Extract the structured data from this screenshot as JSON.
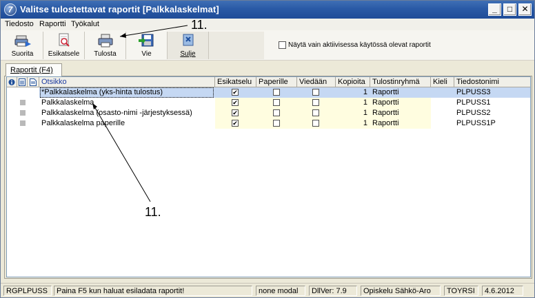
{
  "window": {
    "title": "Valitse tulostettavat raportit [Palkkalaskelmat]",
    "app_icon_glyph": "7",
    "min_glyph": "_",
    "max_glyph": "□",
    "close_glyph": "✕"
  },
  "menu": [
    "Tiedosto",
    "Raportti",
    "Työkalut"
  ],
  "toolbar": {
    "suorita": "Suorita",
    "esikatsele": "Esikatsele",
    "tulosta": "Tulosta",
    "vie": "Vie",
    "sulje": "Sulje"
  },
  "filter_label": "Näytä vain aktiivisessa käytössä olevat raportit",
  "tab_label": "Raportit (F4)",
  "columns": {
    "otsikko": "Otsikko",
    "esikatselu": "Esikatselu",
    "paperille": "Paperille",
    "viedaan": "Viedään",
    "kopioita": "Kopioita",
    "tulostinryhma": "Tulostinryhmä",
    "kieli": "Kieli",
    "tiedostonimi": "Tiedostonimi"
  },
  "rows": [
    {
      "otsikko": "*Palkkalaskelma (yks-hinta tulostus)",
      "esikatselu": true,
      "paperille": false,
      "viedaan": false,
      "kopioita": "1",
      "tulostinryhma": "Raportti",
      "kieli": "",
      "tiedostonimi": "PLPUSS3"
    },
    {
      "otsikko": "Palkkalaskelma",
      "esikatselu": true,
      "paperille": false,
      "viedaan": false,
      "kopioita": "1",
      "tulostinryhma": "Raportti",
      "kieli": "",
      "tiedostonimi": "PLPUSS1"
    },
    {
      "otsikko": "Palkkalaskelma (osasto-nimi -järjestyksessä)",
      "esikatselu": true,
      "paperille": false,
      "viedaan": false,
      "kopioita": "1",
      "tulostinryhma": "Raportti",
      "kieli": "",
      "tiedostonimi": "PLPUSS2"
    },
    {
      "otsikko": "Palkkalaskelma paperille",
      "esikatselu": true,
      "paperille": false,
      "viedaan": false,
      "kopioita": "1",
      "tulostinryhma": "Raportti",
      "kieli": "",
      "tiedostonimi": "PLPUSS1P"
    }
  ],
  "status": {
    "program": "RGPLPUSS",
    "hint": "Paina F5 kun haluat esiladata raportit!",
    "mode": "none modal",
    "dllver": "DllVer: 7.9",
    "user": "Opiskelu Sähkö-Aro",
    "db": "TOYRSI",
    "date": "4.6.2012"
  },
  "annotations": {
    "top": "11.",
    "middle": "11."
  },
  "colors": {
    "titlebar": "#2a5aa6",
    "selected_row": "#c5d8f3",
    "yellow_column": "#fffde0"
  }
}
